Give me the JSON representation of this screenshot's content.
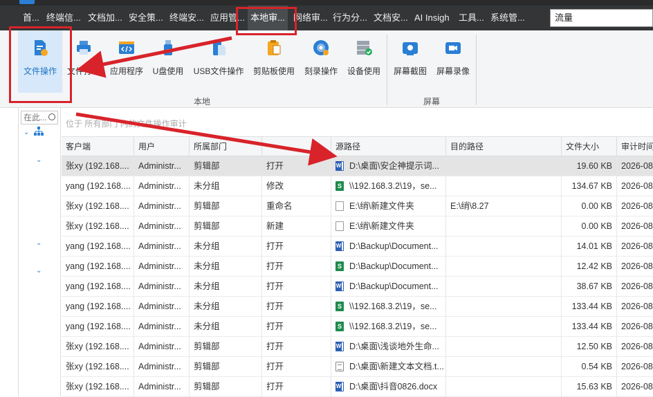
{
  "menubar": {
    "items": [
      "首...",
      "终端信...",
      "文档加...",
      "安全策...",
      "终端安...",
      "应用管...",
      "本地审...",
      "网络审...",
      "行为分...",
      "文档安...",
      "AI Insigh",
      "工具...",
      "系统管..."
    ],
    "search_value": "流量"
  },
  "ribbon": {
    "buttons": [
      "文件操作",
      "文件打印",
      "应用程序",
      "U盘使用",
      "USB文件操作",
      "剪贴板使用",
      "刻录操作",
      "设备使用",
      "屏幕截图",
      "屏幕录像"
    ],
    "groups": [
      "本地",
      "屏幕"
    ]
  },
  "left_panel": {
    "search_placeholder": "在此..."
  },
  "filter": {
    "text": "位于 所有部门 内的文件操作审计"
  },
  "table": {
    "columns": [
      "客户端",
      "用户",
      "所属部门",
      "",
      "源路径",
      "目的路径",
      "文件大小",
      "审计时间"
    ],
    "rows": [
      {
        "client": "张xy (192.168....",
        "user": "Administr...",
        "dept": "剪辑部",
        "action": "打开",
        "icon": "word-file-icon",
        "src": "D:\\桌面\\安企神提示词...",
        "dst": "",
        "size": "19.60 KB",
        "time": "2026-08"
      },
      {
        "client": "yang (192.168....",
        "user": "Administr...",
        "dept": "未分组",
        "action": "修改",
        "icon": "excel-file-icon",
        "src": "\\\\192.168.3.2\\19，se...",
        "dst": "",
        "size": "134.67 KB",
        "time": "2026-08"
      },
      {
        "client": "张xy (192.168....",
        "user": "Administr...",
        "dept": "剪辑部",
        "action": "重命名",
        "icon": "blank-file-icon",
        "src": "E:\\绡\\新建文件夹",
        "dst": "E:\\绡\\8.27",
        "size": "0.00 KB",
        "time": "2026-08"
      },
      {
        "client": "张xy (192.168....",
        "user": "Administr...",
        "dept": "剪辑部",
        "action": "新建",
        "icon": "blank-file-icon",
        "src": "E:\\绡\\新建文件夹",
        "dst": "",
        "size": "0.00 KB",
        "time": "2026-08"
      },
      {
        "client": "yang (192.168....",
        "user": "Administr...",
        "dept": "未分组",
        "action": "打开",
        "icon": "word-file-icon",
        "src": "D:\\Backup\\Document...",
        "dst": "",
        "size": "14.01 KB",
        "time": "2026-08"
      },
      {
        "client": "yang (192.168....",
        "user": "Administr...",
        "dept": "未分组",
        "action": "打开",
        "icon": "excel-file-icon",
        "src": "D:\\Backup\\Document...",
        "dst": "",
        "size": "12.42 KB",
        "time": "2026-08"
      },
      {
        "client": "yang (192.168....",
        "user": "Administr...",
        "dept": "未分组",
        "action": "打开",
        "icon": "word-file-icon",
        "src": "D:\\Backup\\Document...",
        "dst": "",
        "size": "38.67 KB",
        "time": "2026-08"
      },
      {
        "client": "yang (192.168....",
        "user": "Administr...",
        "dept": "未分组",
        "action": "打开",
        "icon": "excel-file-icon",
        "src": "\\\\192.168.3.2\\19，se...",
        "dst": "",
        "size": "133.44 KB",
        "time": "2026-08"
      },
      {
        "client": "yang (192.168....",
        "user": "Administr...",
        "dept": "未分组",
        "action": "打开",
        "icon": "excel-file-icon",
        "src": "\\\\192.168.3.2\\19，se...",
        "dst": "",
        "size": "133.44 KB",
        "time": "2026-08"
      },
      {
        "client": "张xy (192.168....",
        "user": "Administr...",
        "dept": "剪辑部",
        "action": "打开",
        "icon": "word-file-icon",
        "src": "D:\\桌面\\浅谈地外生命...",
        "dst": "",
        "size": "12.50 KB",
        "time": "2026-08"
      },
      {
        "client": "张xy (192.168....",
        "user": "Administr...",
        "dept": "剪辑部",
        "action": "打开",
        "icon": "text-file-icon",
        "src": "D:\\桌面\\新建文本文档.t...",
        "dst": "",
        "size": "0.54 KB",
        "time": "2026-08"
      },
      {
        "client": "张xy (192.168....",
        "user": "Administr...",
        "dept": "剪辑部",
        "action": "打开",
        "icon": "word-file-icon",
        "src": "D:\\桌面\\抖音0826.docx",
        "dst": "",
        "size": "15.63 KB",
        "time": "2026-08"
      }
    ]
  },
  "colors": {
    "annotation": "#d8232a",
    "accent": "#2a7fd4",
    "menubar": "#333537"
  }
}
